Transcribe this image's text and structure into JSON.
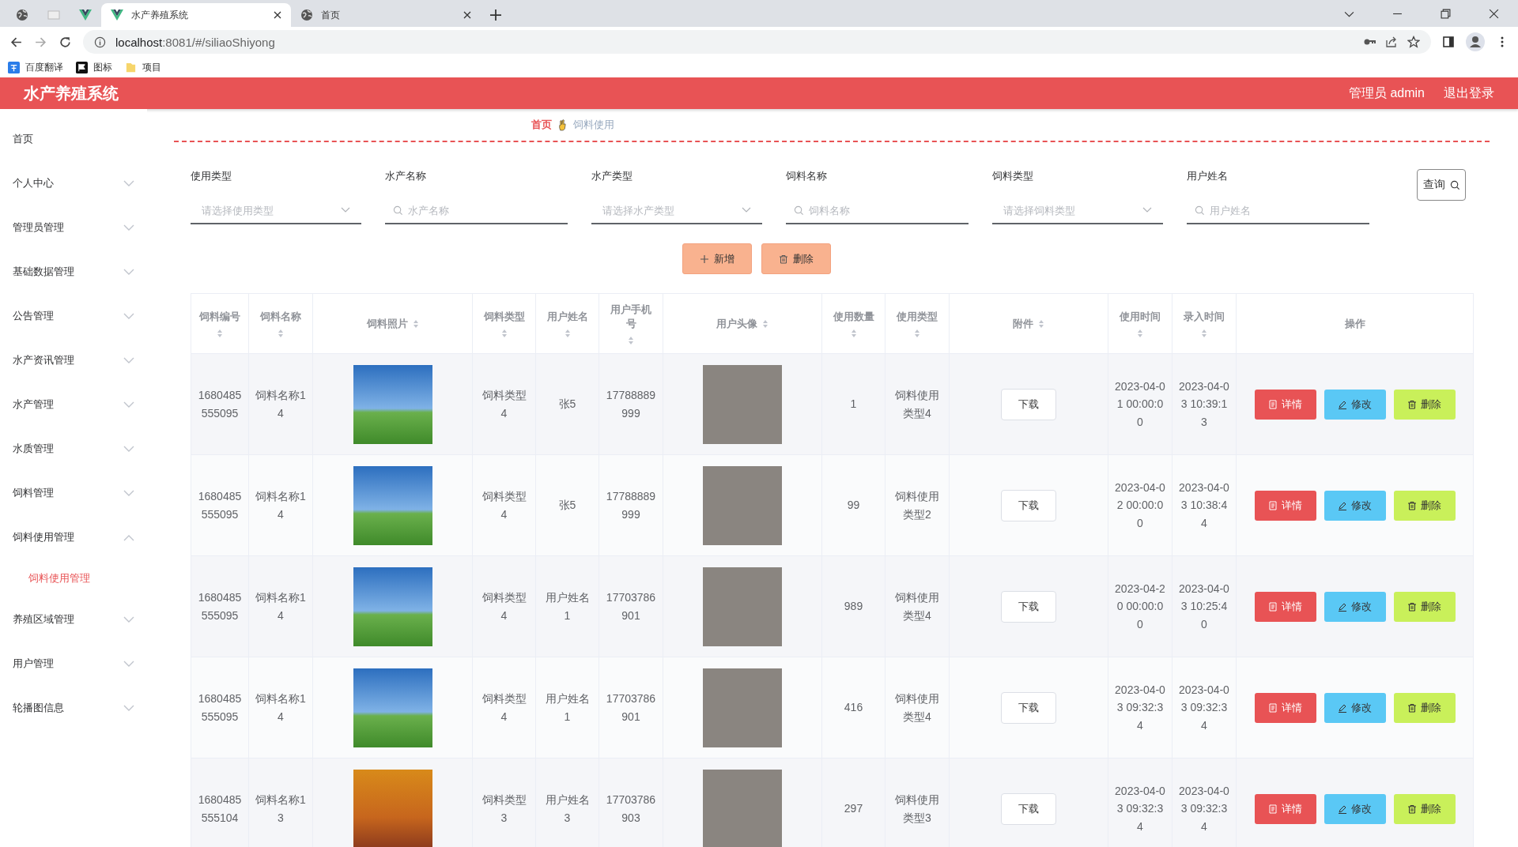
{
  "browser": {
    "tabs": [
      {
        "kind": "pinned",
        "selected": false
      },
      {
        "kind": "pinned",
        "selected": false
      },
      {
        "kind": "pinned",
        "selected": false
      },
      {
        "kind": "full",
        "title": "水产养殖系统",
        "selected": true
      },
      {
        "kind": "full",
        "title": "首页",
        "selected": false
      }
    ],
    "url_host": "localhost",
    "url_rest": ":8081/#/siliaoShiyong",
    "bookmarks": [
      {
        "label": "百度翻译"
      },
      {
        "label": "图标"
      },
      {
        "label": "项目"
      }
    ]
  },
  "header": {
    "title": "水产养殖系统",
    "user": "管理员 admin",
    "logout": "退出登录"
  },
  "sidebar": {
    "items": [
      {
        "kind": "link",
        "label": "首页"
      },
      {
        "kind": "menu",
        "label": "个人中心",
        "expanded": false
      },
      {
        "kind": "menu",
        "label": "管理员管理",
        "expanded": false
      },
      {
        "kind": "menu",
        "label": "基础数据管理",
        "expanded": false
      },
      {
        "kind": "menu",
        "label": "公告管理",
        "expanded": false
      },
      {
        "kind": "menu",
        "label": "水产资讯管理",
        "expanded": false
      },
      {
        "kind": "menu",
        "label": "水产管理",
        "expanded": false
      },
      {
        "kind": "menu",
        "label": "水质管理",
        "expanded": false
      },
      {
        "kind": "menu",
        "label": "饲料管理",
        "expanded": false
      },
      {
        "kind": "menu",
        "label": "饲料使用管理",
        "expanded": true,
        "children": [
          {
            "label": "饲料使用管理",
            "selected": true
          }
        ]
      },
      {
        "kind": "menu",
        "label": "养殖区域管理",
        "expanded": false
      },
      {
        "kind": "menu",
        "label": "用户管理",
        "expanded": false
      },
      {
        "kind": "menu",
        "label": "轮播图信息",
        "expanded": false
      }
    ]
  },
  "breadcrumb": [
    "首页",
    "饲料使用"
  ],
  "filters": [
    {
      "kind": "select",
      "label": "使用类型",
      "placeholder": "请选择使用类型"
    },
    {
      "kind": "input",
      "label": "水产名称",
      "placeholder": "水产名称"
    },
    {
      "kind": "select",
      "label": "水产类型",
      "placeholder": "请选择水产类型"
    },
    {
      "kind": "input",
      "label": "饲料名称",
      "placeholder": "饲料名称"
    },
    {
      "kind": "select",
      "label": "饲料类型",
      "placeholder": "请选择饲料类型"
    },
    {
      "kind": "input",
      "label": "用户姓名",
      "placeholder": "用户姓名"
    }
  ],
  "query_button": "查询",
  "toolbar": [
    "新增",
    "删除"
  ],
  "table": {
    "columns": [
      {
        "label": "饲料编号",
        "sortable": true
      },
      {
        "label": "饲料名称",
        "sortable": true
      },
      {
        "label": "饲料照片",
        "sortable": true
      },
      {
        "label": "饲料类型",
        "sortable": true
      },
      {
        "label": "用户姓名",
        "sortable": true
      },
      {
        "label": "用户手机号",
        "sortable": true
      },
      {
        "label": "用户头像",
        "sortable": true
      },
      {
        "label": "使用数量",
        "sortable": true
      },
      {
        "label": "使用类型",
        "sortable": true
      },
      {
        "label": "附件",
        "sortable": true
      },
      {
        "label": "使用时间",
        "sortable": true
      },
      {
        "label": "录入时间",
        "sortable": true
      },
      {
        "label": "操作",
        "sortable": false
      }
    ],
    "rows": [
      {
        "id": "1680485555095",
        "name": "饲料名称14",
        "type": "饲料类型4",
        "user": "张5",
        "phone": "17788889999",
        "qty": "1",
        "use_type": "饲料使用类型4",
        "file": "下载",
        "used": "2023-04-01 00:00:00",
        "created": "2023-04-03 10:39:13",
        "actions": [
          {
            "kind": "detail",
            "label": "详情"
          },
          {
            "kind": "edit",
            "label": "修改"
          },
          {
            "kind": "delete",
            "label": "删除"
          }
        ]
      },
      {
        "id": "1680485555095",
        "name": "饲料名称14",
        "type": "饲料类型4",
        "user": "张5",
        "phone": "17788889999",
        "qty": "99",
        "use_type": "饲料使用类型2",
        "file": "下载",
        "used": "2023-04-02 00:00:00",
        "created": "2023-04-03 10:38:44",
        "actions": [
          {
            "kind": "detail",
            "label": "详情"
          },
          {
            "kind": "edit",
            "label": "修改"
          },
          {
            "kind": "delete",
            "label": "删除"
          }
        ]
      },
      {
        "id": "1680485555095",
        "name": "饲料名称14",
        "type": "饲料类型4",
        "user": "用户姓名1",
        "phone": "17703786901",
        "qty": "989",
        "use_type": "饲料使用类型4",
        "file": "下载",
        "used": "2023-04-20 00:00:00",
        "created": "2023-04-03 10:25:40",
        "actions": [
          {
            "kind": "detail",
            "label": "详情"
          },
          {
            "kind": "edit",
            "label": "修改"
          },
          {
            "kind": "delete",
            "label": "删除"
          }
        ]
      },
      {
        "id": "1680485555095",
        "name": "饲料名称14",
        "type": "饲料类型4",
        "user": "用户姓名1",
        "phone": "17703786901",
        "qty": "416",
        "use_type": "饲料使用类型4",
        "file": "下载",
        "used": "2023-04-03 09:32:34",
        "created": "2023-04-03 09:32:34",
        "actions": [
          {
            "kind": "detail",
            "label": "详情"
          },
          {
            "kind": "edit",
            "label": "修改"
          },
          {
            "kind": "delete",
            "label": "删除"
          }
        ]
      },
      {
        "id": "1680485555104",
        "name": "饲料名称13",
        "type": "饲料类型3",
        "user": "用户姓名3",
        "phone": "17703786903",
        "qty": "297",
        "use_type": "饲料使用类型3",
        "file": "下载",
        "used": "2023-04-03 09:32:34",
        "created": "2023-04-03 09:32:34",
        "actions": [
          {
            "kind": "detail",
            "label": "详情"
          },
          {
            "kind": "edit",
            "label": "修改"
          },
          {
            "kind": "delete",
            "label": "删除"
          }
        ]
      }
    ]
  }
}
